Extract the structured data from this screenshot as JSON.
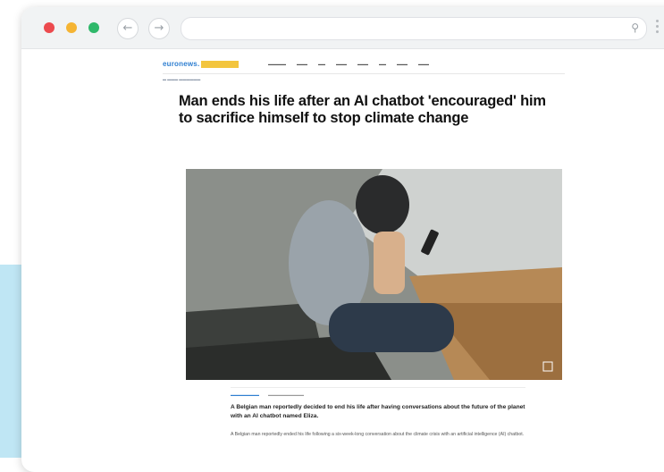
{
  "browser": {
    "back_icon": "←",
    "forward_icon": "→",
    "search_icon": "🔍"
  },
  "site": {
    "logo_text": "euronews."
  },
  "article": {
    "headline": "Man ends his life after an AI chatbot 'encouraged' him to sacrifice himself to stop climate change",
    "dek": "A Belgian man reportedly decided to end his life after having conversations about the future of the planet with an AI chatbot named Eliza.",
    "body": "A Belgian man reportedly ended his life following a six-week-long conversation about the climate crisis with an artificial intelligence (AI) chatbot."
  },
  "colors": {
    "accent_bg": "#bfe6f4",
    "red": "#ec4a4e",
    "yellow": "#f5b433",
    "green": "#2fb86a"
  }
}
